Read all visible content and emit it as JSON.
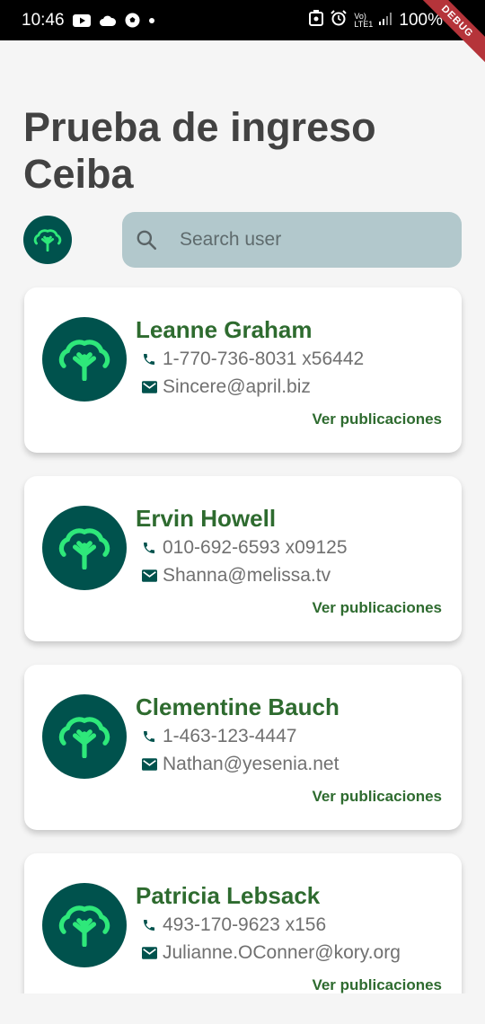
{
  "status_bar": {
    "time": "10:46",
    "battery": "100%",
    "network": "Vo) LTE1",
    "icons_left": [
      "youtube-icon",
      "cloud-icon",
      "soccer-ball-icon",
      "dot-icon"
    ],
    "icons_right": [
      "nfc-icon",
      "alarm-icon",
      "signal-icon",
      "battery-icon"
    ]
  },
  "debug_banner": "DEBUG",
  "page": {
    "title": "Prueba de ingreso Ceiba"
  },
  "search": {
    "placeholder": "Search user",
    "value": ""
  },
  "users": [
    {
      "name": "Leanne Graham",
      "phone": "1-770-736-8031 x56442",
      "email": "Sincere@april.biz",
      "action": "Ver publicaciones"
    },
    {
      "name": "Ervin Howell",
      "phone": "010-692-6593 x09125",
      "email": "Shanna@melissa.tv",
      "action": "Ver publicaciones"
    },
    {
      "name": "Clementine Bauch",
      "phone": "1-463-123-4447",
      "email": "Nathan@yesenia.net",
      "action": "Ver publicaciones"
    },
    {
      "name": "Patricia Lebsack",
      "phone": "493-170-9623 x156",
      "email": "Julianne.OConner@kory.org",
      "action": "Ver publicaciones"
    }
  ],
  "colors": {
    "brand_dark": "#00524d",
    "brand_light": "#2ee87a",
    "title_green": "#2e6b2f",
    "search_bg": "#b2c8cc"
  }
}
